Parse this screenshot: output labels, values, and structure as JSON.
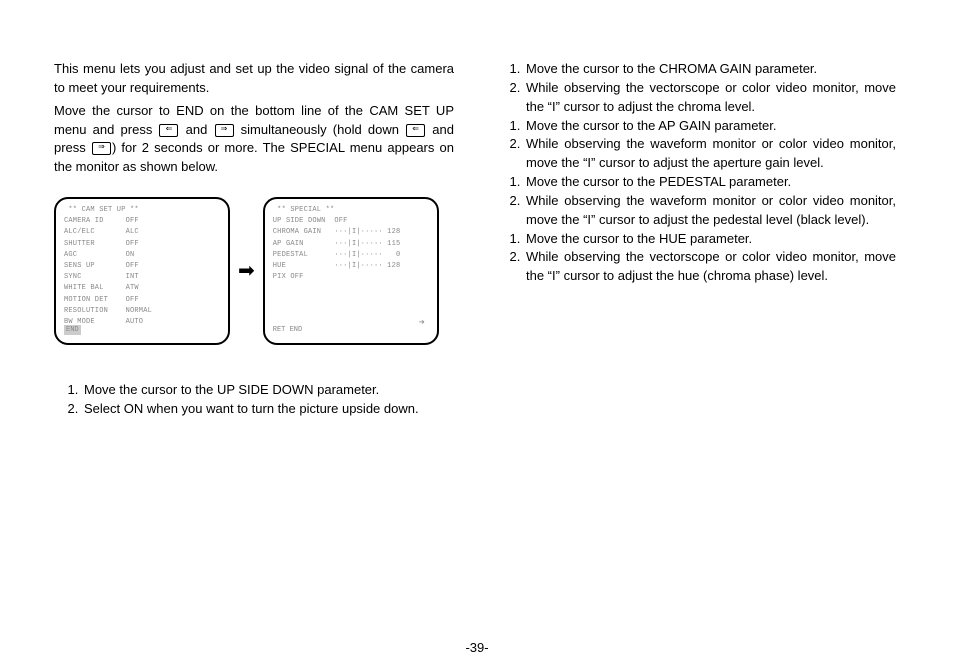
{
  "left": {
    "intro1": "This menu lets you adjust and set up the video signal of the camera to meet your requirements.",
    "intro2_a": "Move the cursor to END on the bottom line of the CAM SET UP menu and press ",
    "intro2_and": " and ",
    "intro2_b": " simultaneously (hold down ",
    "intro2_c": " and press ",
    "intro2_d": ") for 2 seconds or more. The SPECIAL menu appears on the monitor as shown below.",
    "screen1": " ** CAM SET UP **\nCAMERA ID     OFF\nALC/ELC       ALC\nSHUTTER       OFF\nAGC           ON\nSENS UP       OFF\nSYNC          INT\nWHITE BAL     ATW\nMOTION DET    OFF\nRESOLUTION    NORMAL\nBW MODE       AUTO",
    "screen1_end": "END",
    "screen2": " ** SPECIAL **\nUP SIDE DOWN  OFF\nCHROMA GAIN   ···|I|····· 128\nAP GAIN       ···|I|····· 115\nPEDESTAL      ···|I|·····   0\nHUE           ···|I|····· 128\nPIX OFF",
    "screen2_ret": "RET  END",
    "upside": {
      "s1": "Move the cursor to the UP SIDE DOWN parameter.",
      "s2": "Select ON when you want to turn the picture upside down."
    }
  },
  "right": {
    "chroma": {
      "s1": "Move the cursor to the CHROMA GAIN parameter.",
      "s2": "While observing the vectorscope or color video monitor, move the “I” cursor to adjust the chroma level."
    },
    "apgain": {
      "s1": "Move the cursor to the AP GAIN parameter.",
      "s2": "While observing the waveform monitor or color video monitor, move the “I” cursor to adjust the aperture gain level."
    },
    "pedestal": {
      "s1": "Move the cursor to the PEDESTAL parameter.",
      "s2": "While observing the waveform monitor or color video monitor, move the “I” cursor to adjust the pedestal level (black level)."
    },
    "hue": {
      "s1": "Move the cursor to the HUE parameter.",
      "s2": "While observing the vectorscope or color video monitor, move the “I” cursor to adjust the hue (chroma phase) level."
    }
  },
  "pagenum": "-39-"
}
